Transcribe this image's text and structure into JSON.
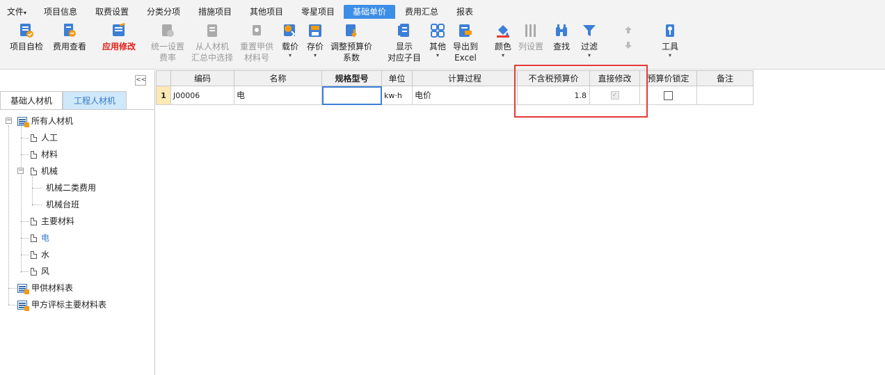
{
  "menubar": {
    "items": [
      "文件",
      "项目信息",
      "取费设置",
      "分类分项",
      "措施项目",
      "其他项目",
      "零星项目",
      "基础单价",
      "费用汇总",
      "报表"
    ],
    "active": "基础单价"
  },
  "toolbar": {
    "buttons": [
      {
        "label1": "项目自检",
        "label2": "",
        "state": "normal",
        "icon": "check-list-icon"
      },
      {
        "label1": "费用查看",
        "label2": "",
        "state": "normal",
        "icon": "doc-view-icon"
      },
      {
        "label1": "应用修改",
        "label2": "",
        "state": "highlight",
        "icon": "apply-edit-icon"
      },
      {
        "label1": "统一设置",
        "label2": "费率",
        "state": "disabled",
        "icon": "rate-icon"
      },
      {
        "label1": "从人材机",
        "label2": "汇总中选择",
        "state": "disabled",
        "icon": "select-summary-icon"
      },
      {
        "label1": "重置甲供",
        "label2": "材料号",
        "state": "disabled",
        "icon": "reset-icon"
      },
      {
        "label1": "载价",
        "label2": "▾",
        "state": "normal",
        "icon": "load-price-icon"
      },
      {
        "label1": "存价",
        "label2": "▾",
        "state": "normal",
        "icon": "save-price-icon"
      },
      {
        "label1": "调整预算价",
        "label2": "系数",
        "state": "normal",
        "icon": "adjust-icon"
      },
      {
        "label1": "显示",
        "label2": "对应子目",
        "state": "normal",
        "icon": "show-sub-icon"
      },
      {
        "label1": "其他",
        "label2": "▾",
        "state": "normal",
        "icon": "grid-icon"
      },
      {
        "label1": "导出到",
        "label2": "Excel",
        "state": "normal",
        "icon": "excel-icon"
      },
      {
        "label1": "颜色",
        "label2": "▾",
        "state": "normal",
        "icon": "paint-bucket-icon"
      },
      {
        "label1": "列设置",
        "label2": "",
        "state": "disabled",
        "icon": "columns-icon"
      },
      {
        "label1": "查找",
        "label2": "",
        "state": "normal",
        "icon": "binoculars-icon"
      },
      {
        "label1": "过滤",
        "label2": "▾",
        "state": "normal",
        "icon": "filter-icon"
      },
      {
        "label1": "",
        "label2": "",
        "state": "disabled",
        "icon": "move-up-down-icon"
      },
      {
        "label1": "工具",
        "label2": "▾",
        "state": "normal",
        "icon": "tools-icon"
      }
    ]
  },
  "leftpanel": {
    "collapse_glyph": "<<",
    "tabs": [
      "基础人材机",
      "工程人材机"
    ],
    "tree": [
      {
        "label": "所有人材机",
        "type": "table",
        "level": 0,
        "expander": "−"
      },
      {
        "label": "人工",
        "type": "doc",
        "level": 1,
        "expander": ""
      },
      {
        "label": "材料",
        "type": "doc",
        "level": 1,
        "expander": ""
      },
      {
        "label": "机械",
        "type": "doc",
        "level": 1,
        "expander": "−"
      },
      {
        "label": "机械二类费用",
        "type": "none",
        "level": 2,
        "expander": ""
      },
      {
        "label": "机械台班",
        "type": "none",
        "level": 2,
        "expander": ""
      },
      {
        "label": "主要材料",
        "type": "doc",
        "level": 1,
        "expander": ""
      },
      {
        "label": "电",
        "type": "doc",
        "level": 1,
        "expander": "",
        "selected": true
      },
      {
        "label": "水",
        "type": "doc",
        "level": 1,
        "expander": ""
      },
      {
        "label": "风",
        "type": "doc",
        "level": 1,
        "expander": ""
      },
      {
        "label": "甲供材料表",
        "type": "table",
        "level": 0,
        "expander": ""
      },
      {
        "label": "甲方评标主要材料表",
        "type": "table",
        "level": 0,
        "expander": ""
      }
    ]
  },
  "grid": {
    "headers": [
      "",
      "编码",
      "名称",
      "规格型号",
      "单位",
      "计算过程",
      "不含税预算价",
      "直接修改",
      "预算价锁定",
      "备注"
    ],
    "rows": [
      {
        "no": "1",
        "code": "J00006",
        "name": "电",
        "spec": "",
        "unit": "kw·h",
        "calc": "电价",
        "price": "1.8",
        "direct_edit": true,
        "price_lock": false,
        "remark": ""
      }
    ]
  },
  "colors": {
    "accent": "#3c8ee6",
    "highlight_red": "#e53935",
    "selected_tab": "#cfe8fa"
  }
}
